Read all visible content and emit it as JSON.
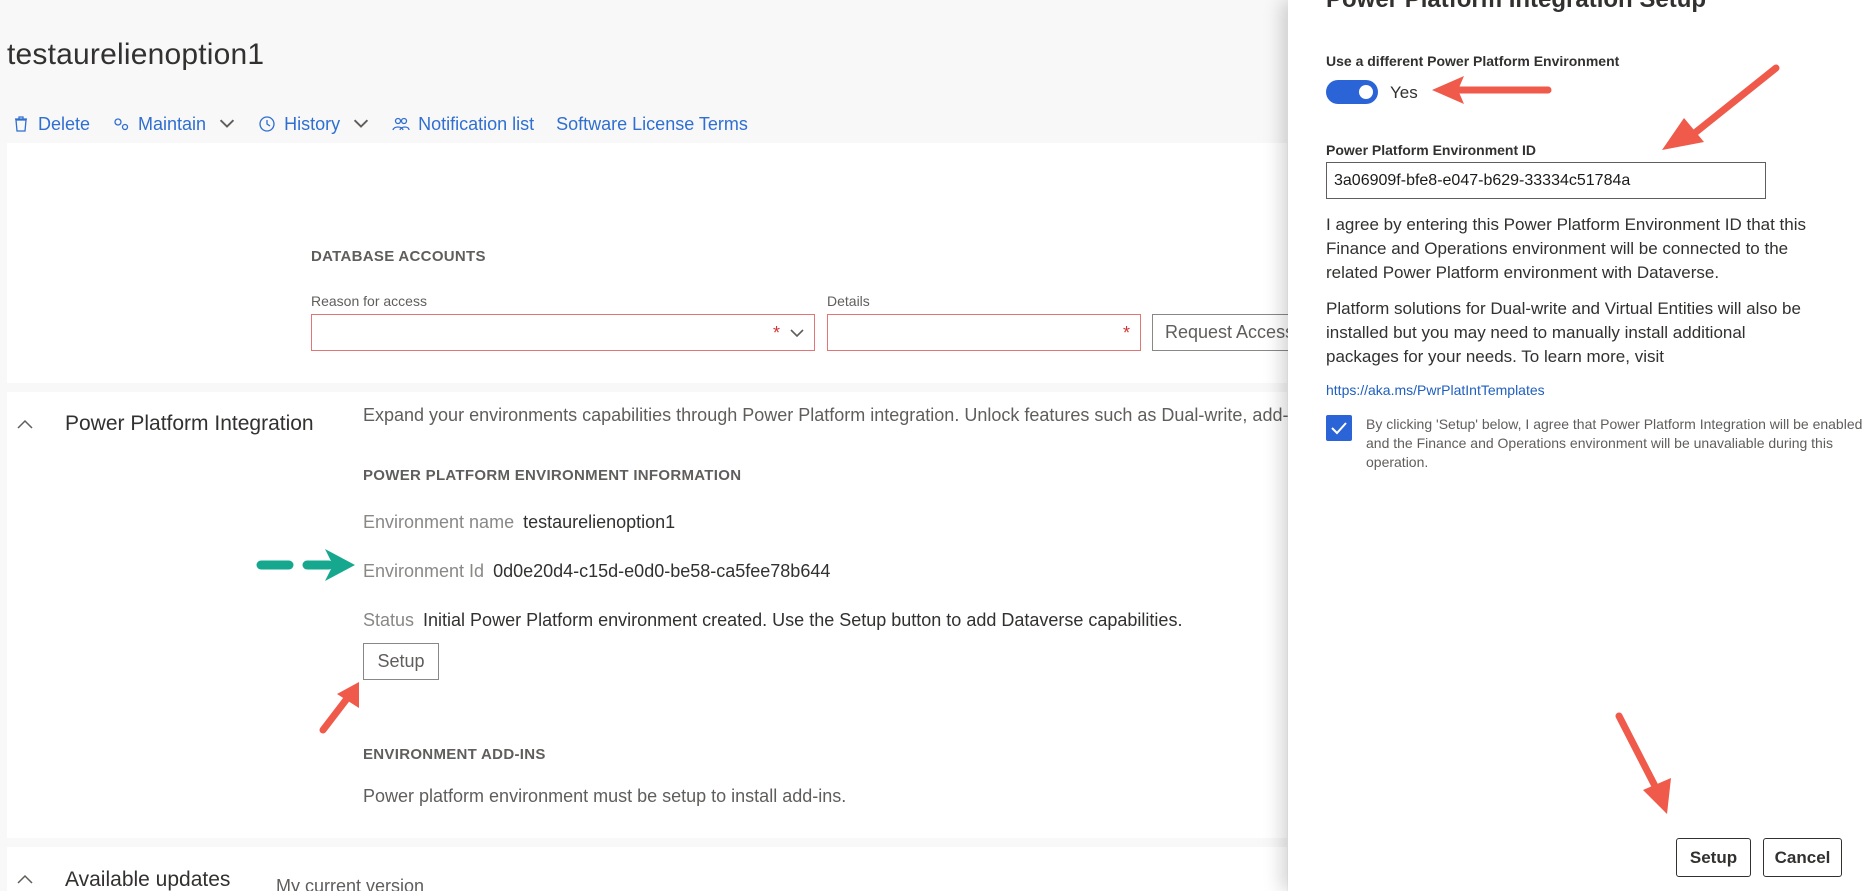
{
  "page": {
    "title": "testaurelienoption1"
  },
  "actions": [
    {
      "label": "Delete",
      "icon": "trash-icon"
    },
    {
      "label": "Maintain",
      "icon": "gears-icon",
      "dropdown": true
    },
    {
      "label": "History",
      "icon": "clock-icon",
      "dropdown": true
    },
    {
      "label": "Notification list",
      "icon": "people-icon"
    },
    {
      "label": "Software License Terms"
    }
  ],
  "database_accounts": {
    "title": "DATABASE ACCOUNTS",
    "reason_label": "Reason for access",
    "reason_value": "",
    "details_label": "Details",
    "details_value": "",
    "required_marker": "*",
    "request_button": "Request Access"
  },
  "ppi": {
    "title": "Power Platform Integration",
    "description": "Expand your environments capabilities through Power Platform integration. Unlock features such as Dual-write, add-ins",
    "env_info_title": "POWER PLATFORM ENVIRONMENT INFORMATION",
    "env_name_label": "Environment name",
    "env_name_value": "testaurelienoption1",
    "env_id_label": "Environment Id",
    "env_id_value": "0d0e20d4-c15d-e0d0-be58-ca5fee78b644",
    "status_label": "Status",
    "status_value": "Initial Power Platform environment created. Use the Setup button to add Dataverse capabilities.",
    "setup_button": "Setup",
    "addins_title": "ENVIRONMENT ADD-INS",
    "addins_text": "Power platform environment must be setup to install add-ins."
  },
  "updates": {
    "title": "Available updates",
    "subtitle": "My current version"
  },
  "panel": {
    "title": "Power Platform Integration Setup",
    "toggle_label": "Use a different Power Platform Environment",
    "toggle_on": true,
    "toggle_value": "Yes",
    "env_id_label": "Power Platform Environment ID",
    "env_id_value": "3a06909f-bfe8-e047-b629-33334c51784a",
    "agree_text": "I agree by entering this Power Platform Environment ID that this Finance and Operations environment will be connected to the related Power Platform environment with Dataverse.",
    "solutions_text": "Platform solutions for Dual-write and Virtual Entities will also be installed but you may need to manually install additional packages for your needs. To learn more, visit",
    "link": "https://aka.ms/PwrPlatIntTemplates",
    "checkbox_checked": true,
    "checkbox_text": "By clicking 'Setup' below, I agree that Power Platform Integration will be enabled and the Finance and Operations environment will be unavaliable during this operation.",
    "setup_button": "Setup",
    "cancel_button": "Cancel"
  },
  "colors": {
    "accent": "#2a64d6",
    "link": "#2f6fd1",
    "annotation_red": "#ef5a4b",
    "annotation_teal": "#16a88f"
  }
}
